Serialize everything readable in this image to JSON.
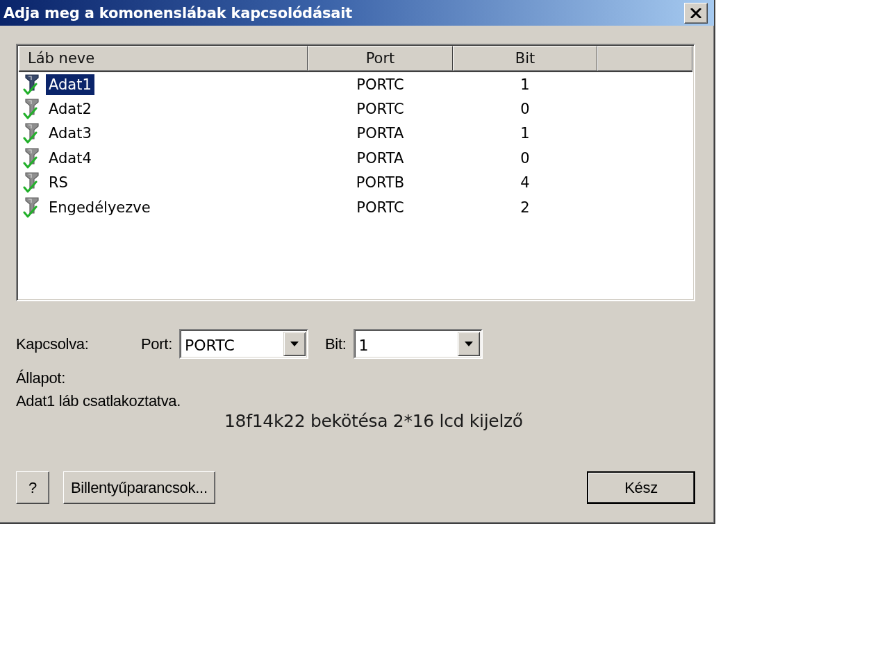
{
  "window": {
    "title": "Adja meg a komonenslábak kapcsolódásait"
  },
  "pin_table": {
    "columns": [
      "Láb neve",
      "Port",
      "Bit"
    ],
    "rows": [
      {
        "name": "Adat1",
        "port": "PORTC",
        "bit": "1",
        "selected": true,
        "connected": true
      },
      {
        "name": "Adat2",
        "port": "PORTC",
        "bit": "0",
        "selected": false,
        "connected": true
      },
      {
        "name": "Adat3",
        "port": "PORTA",
        "bit": "1",
        "selected": false,
        "connected": true
      },
      {
        "name": "Adat4",
        "port": "PORTA",
        "bit": "0",
        "selected": false,
        "connected": true
      },
      {
        "name": "RS",
        "port": "PORTB",
        "bit": "4",
        "selected": false,
        "connected": true
      },
      {
        "name": "Engedélyezve",
        "port": "PORTC",
        "bit": "2",
        "selected": false,
        "connected": true
      }
    ]
  },
  "connection": {
    "label": "Kapcsolva:",
    "port": {
      "label": "Port:",
      "value": "PORTC"
    },
    "bit": {
      "label": "Bit:",
      "value": "1"
    }
  },
  "status": {
    "label": "Állapot:",
    "message": "Adat1 láb csatlakoztatva."
  },
  "caption": "18f14k22 bekötésa 2*16 lcd kijelző",
  "buttons": [
    {
      "label": "?",
      "kind": "help"
    },
    {
      "label": "Billentyűparancsok...",
      "kind": "plain"
    },
    {
      "label": "Kész",
      "kind": "default"
    }
  ]
}
